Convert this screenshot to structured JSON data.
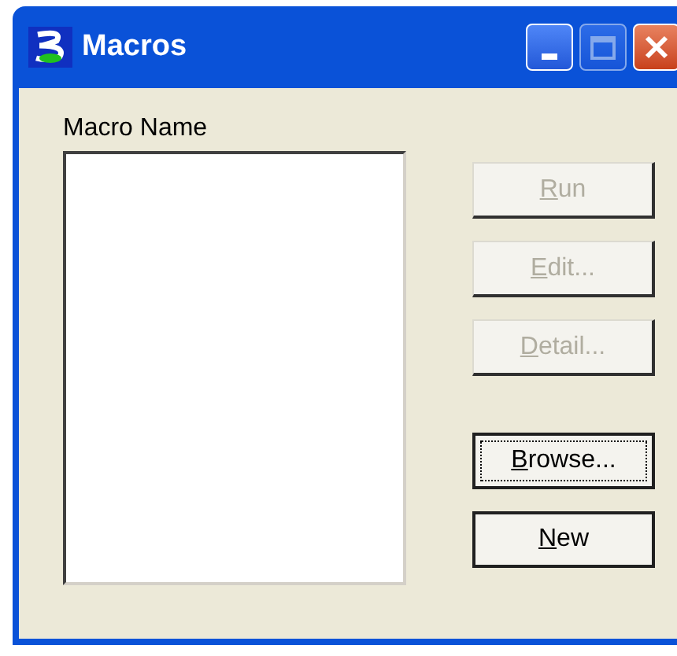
{
  "window": {
    "title": "Macros",
    "controls": [
      {
        "kind": "minimize",
        "disabled": false
      },
      {
        "kind": "maximize",
        "disabled": true
      },
      {
        "kind": "close",
        "disabled": false
      }
    ]
  },
  "macro_list": {
    "label": "Macro Name"
  },
  "buttons": [
    {
      "label": "Run",
      "disabled": true,
      "focused": false
    },
    {
      "label": "Edit...",
      "disabled": true,
      "focused": false
    },
    {
      "label": "Detail...",
      "disabled": true,
      "focused": false
    },
    {
      "label": "Browse...",
      "disabled": false,
      "focused": true
    },
    {
      "label": "New",
      "disabled": false,
      "focused": false
    }
  ]
}
